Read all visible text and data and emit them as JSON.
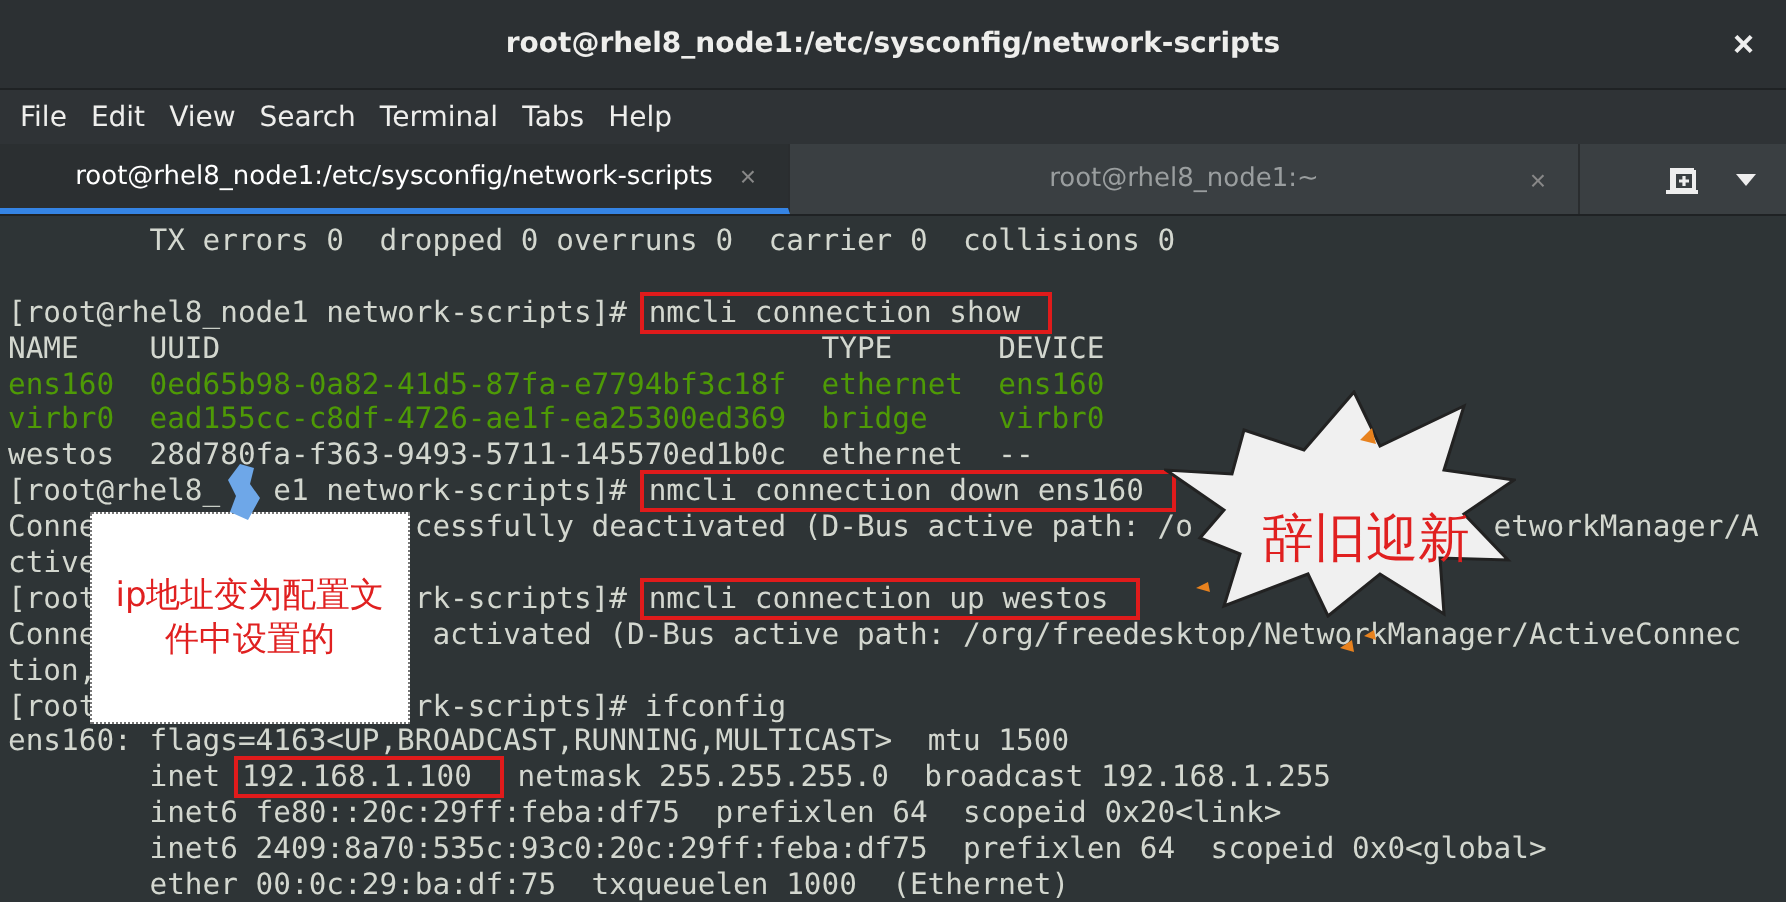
{
  "window": {
    "title": "root@rhel8_node1:/etc/sysconfig/network-scripts",
    "close": "×"
  },
  "menu": [
    "File",
    "Edit",
    "View",
    "Search",
    "Terminal",
    "Tabs",
    "Help"
  ],
  "tabs": [
    {
      "label": "root@rhel8_node1:/etc/sysconfig/network-scripts",
      "close": "×",
      "selected": true
    },
    {
      "label": "root@rhel8_node1:~",
      "close": "×",
      "selected": false
    }
  ],
  "terminal": {
    "lines": [
      {
        "kind": "plain",
        "segments": [
          {
            "text": "        TX errors 0  dropped 0 overruns 0  carrier 0  collisions 0",
            "highlighted": false
          }
        ]
      },
      {
        "kind": "blank"
      },
      {
        "kind": "plain",
        "segments": [
          {
            "text": "[root@rhel8_node1 network-scripts]# ",
            "highlighted": false
          },
          {
            "text": "nmcli connection show",
            "highlighted": true
          }
        ]
      },
      {
        "kind": "plain",
        "segments": [
          {
            "text": "NAME    UUID                                  TYPE      DEVICE",
            "highlighted": false
          }
        ]
      },
      {
        "kind": "active",
        "segments": [
          {
            "text": "ens160  0ed65b98-0a82-41d5-87fa-e7794bf3c18f  ethernet  ens160",
            "highlighted": false
          }
        ]
      },
      {
        "kind": "active",
        "segments": [
          {
            "text": "virbr0  ead155cc-c8df-4726-ae1f-ea25300ed369  bridge    virbr0",
            "highlighted": false
          }
        ]
      },
      {
        "kind": "plain",
        "segments": [
          {
            "text": "westos  28d780fa-f363-9493-5711-145570ed1b0c  ethernet  --",
            "highlighted": false
          }
        ]
      },
      {
        "kind": "plain",
        "segments": [
          {
            "text": "[root@rhel8_",
            "highlighted": false
          },
          {
            "text": "   e1 network-scripts]# ",
            "highlighted": false
          },
          {
            "text": "nmcli connection down ens160",
            "highlighted": true
          }
        ]
      },
      {
        "kind": "plain",
        "segments": [
          {
            "text": "Conne",
            "highlighted": false
          },
          {
            "text": "                  cessfully deactivated (D-Bus active path: /o",
            "highlighted": false
          },
          {
            "text": "                 etworkManager/A",
            "highlighted": false
          }
        ]
      },
      {
        "kind": "plain",
        "segments": [
          {
            "text": "ctive",
            "highlighted": false
          }
        ]
      },
      {
        "kind": "plain",
        "segments": [
          {
            "text": "[root",
            "highlighted": false
          },
          {
            "text": "                  rk-scripts]# ",
            "highlighted": false
          },
          {
            "text": "nmcli connection up westos",
            "highlighted": true
          }
        ]
      },
      {
        "kind": "plain",
        "segments": [
          {
            "text": "Conne",
            "highlighted": false
          },
          {
            "text": "                   activated (D-Bus active path: /org/freedesktop/NetworkManager/ActiveConnec",
            "highlighted": false
          }
        ]
      },
      {
        "kind": "plain",
        "segments": [
          {
            "text": "tion,",
            "highlighted": false
          }
        ]
      },
      {
        "kind": "plain",
        "segments": [
          {
            "text": "[root",
            "highlighted": false
          },
          {
            "text": "                  rk-scripts]# ifconfig",
            "highlighted": false
          }
        ]
      },
      {
        "kind": "plain",
        "segments": [
          {
            "text": "ens160: flags=4163<UP,BROADCAST,RUNNING,MULTICAST>  mtu 1500",
            "highlighted": false
          }
        ]
      },
      {
        "kind": "plain",
        "segments": [
          {
            "text": "        inet ",
            "highlighted": false
          },
          {
            "text": "192.168.1.100",
            "highlighted": true
          },
          {
            "text": " netmask 255.255.255.0  broadcast 192.168.1.255",
            "highlighted": false
          }
        ]
      },
      {
        "kind": "plain",
        "segments": [
          {
            "text": "        inet6 fe80::20c:29ff:feba:df75  prefixlen 64  scopeid 0x20<link>",
            "highlighted": false
          }
        ]
      },
      {
        "kind": "plain",
        "segments": [
          {
            "text": "        inet6 2409:8a70:535c:93c0:20c:29ff:feba:df75  prefixlen 64  scopeid 0x0<global>",
            "highlighted": false
          }
        ]
      },
      {
        "kind": "plain",
        "segments": [
          {
            "text": "        ether 00:0c:29:ba:df:75  txqueuelen 1000  (Ethernet)",
            "highlighted": false
          }
        ]
      }
    ]
  },
  "note": {
    "text": "ip地址变为配置文件中设置的"
  },
  "callout": {
    "text": "辞旧迎新"
  }
}
